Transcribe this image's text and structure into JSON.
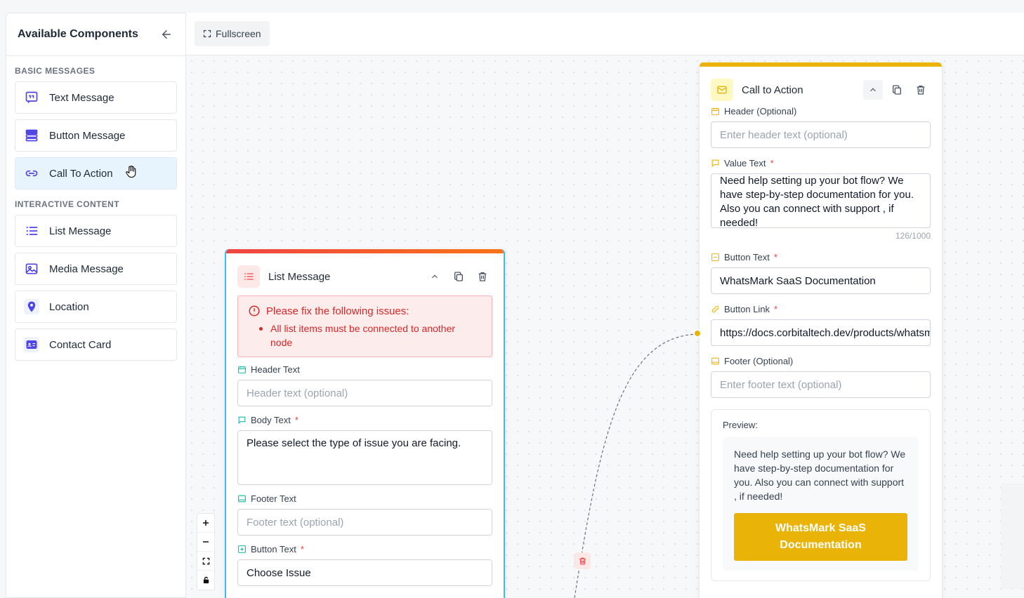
{
  "sidebar": {
    "title": "Available Components",
    "sections": [
      {
        "title": "BASIC MESSAGES",
        "items": [
          {
            "label": "Text Message",
            "icon": "quote-message-icon"
          },
          {
            "label": "Button Message",
            "icon": "button-message-icon"
          },
          {
            "label": "Call To Action",
            "icon": "link-icon"
          }
        ]
      },
      {
        "title": "INTERACTIVE CONTENT",
        "items": [
          {
            "label": "List Message",
            "icon": "list-icon"
          },
          {
            "label": "Media Message",
            "icon": "image-icon"
          },
          {
            "label": "Location",
            "icon": "map-pin-icon"
          },
          {
            "label": "Contact Card",
            "icon": "contact-card-icon"
          }
        ]
      }
    ]
  },
  "toolbar": {
    "fullscreen_label": "Fullscreen"
  },
  "list_node": {
    "title": "List Message",
    "error_title": "Please fix the following issues:",
    "error_item": "All list items must be connected to another node",
    "header_label": "Header Text",
    "header_placeholder": "Header text (optional)",
    "body_label": "Body Text",
    "body_value": "Please select the type of issue you are facing.",
    "footer_label": "Footer Text",
    "footer_placeholder": "Footer text (optional)",
    "button_label": "Button Text",
    "button_value": "Choose Issue"
  },
  "cta_node": {
    "title": "Call to Action",
    "header_label": "Header (Optional)",
    "header_placeholder": "Enter header text (optional)",
    "value_label": "Value Text",
    "value_text": "Need help setting up your bot flow? We have step-by-step documentation for you. Also you can connect with support , if needed!",
    "counter": "126/1000",
    "button_text_label": "Button Text",
    "button_text_value": "WhatsMark SaaS Documentation",
    "button_link_label": "Button Link",
    "button_link_value": "https://docs.corbitaltech.dev/products/whatsmark-saas",
    "footer_label": "Footer (Optional)",
    "footer_placeholder": "Enter footer text (optional)",
    "preview_label": "Preview:",
    "preview_text": "Need help setting up your bot flow? We have step-by-step documentation for you. Also you can connect with support , if needed!",
    "preview_button": "WhatsMark SaaS Documentation"
  },
  "required_mark": "*",
  "colors": {
    "accent": "#eab308",
    "error": "#dc2626",
    "selected_border": "#38bdf8",
    "icon_purple": "#4f46e5",
    "icon_teal": "#14b8a6"
  }
}
